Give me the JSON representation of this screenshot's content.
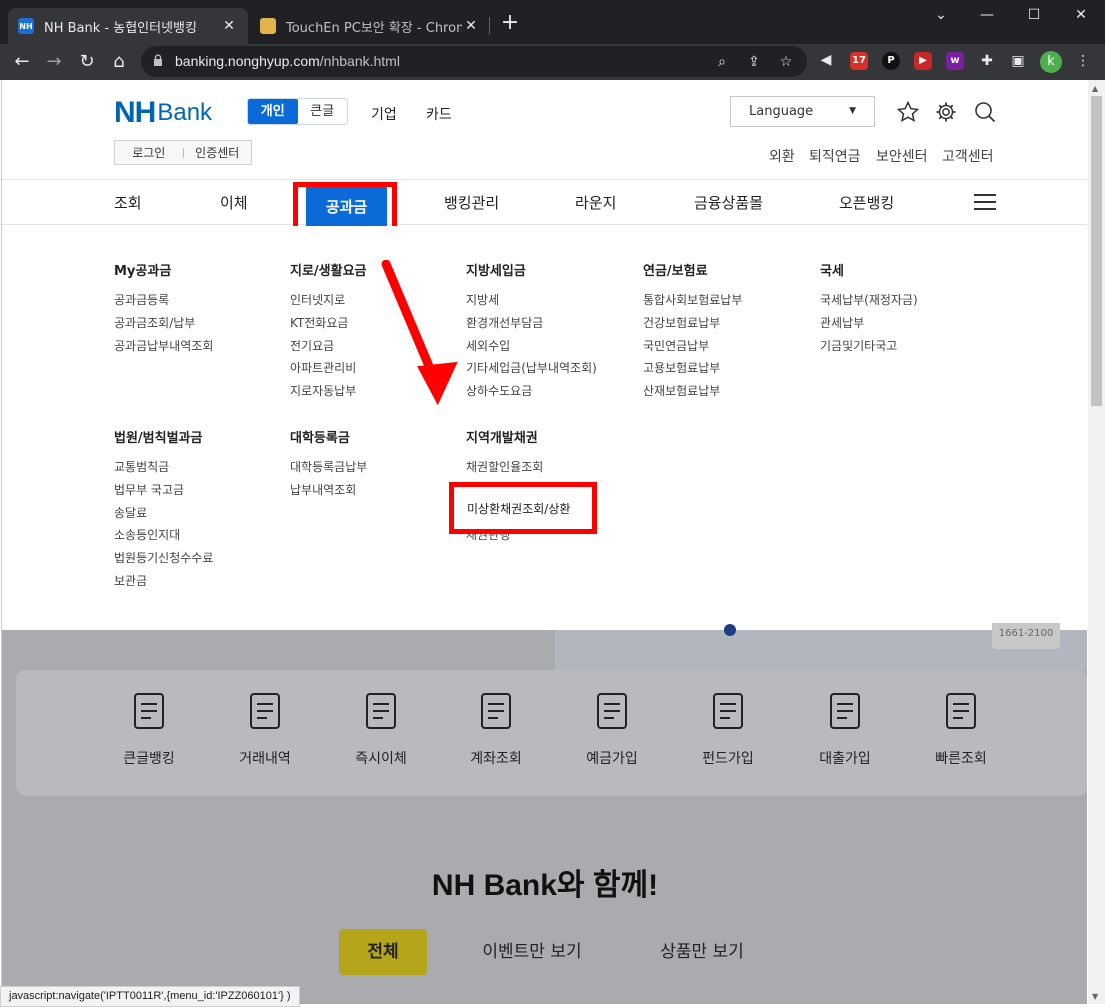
{
  "browser": {
    "tabs": [
      {
        "title": "NH Bank - 농협인터넷뱅킹",
        "favicon": "NH"
      },
      {
        "title": "TouchEn PC보안 확장 - Chrome"
      }
    ],
    "url_host": "banking.nonghyup.com",
    "url_path": "/nhbank.html",
    "extension_badge": "17",
    "profile_initial": "k",
    "status_bar": "javascript:navigate('IPTT0011R',{menu_id:'IPZZ060101'} )"
  },
  "header": {
    "logo_nh": "NH",
    "logo_bank": "Bank",
    "segment": [
      "개인",
      "큰글"
    ],
    "top_links": [
      "기업",
      "카드"
    ],
    "login": "로그인",
    "cert": "인증센터",
    "language": "Language",
    "util_links": [
      "외환",
      "퇴직연금",
      "보안센터",
      "고객센터"
    ]
  },
  "gnb": {
    "items": [
      "조회",
      "이체",
      "공과금",
      "뱅킹관리",
      "라운지",
      "금융상품몰",
      "오픈뱅킹"
    ],
    "active": "공과금"
  },
  "mega_menu": {
    "row1": [
      {
        "title": "My공과금",
        "items": [
          "공과금등록",
          "공과금조회/납부",
          "공과금납부내역조회"
        ]
      },
      {
        "title": "지로/생활요금",
        "items": [
          "인터넷지로",
          "KT전화요금",
          "전기요금",
          "아파트관리비",
          "지로자동납부"
        ]
      },
      {
        "title": "지방세입금",
        "items": [
          "지방세",
          "환경개선부담금",
          "세외수입",
          "기타세입금(납부내역조회)",
          "상하수도요금"
        ]
      },
      {
        "title": "연금/보험료",
        "items": [
          "통합사회보험료납부",
          "건강보험료납부",
          "국민연금납부",
          "고용보험료납부",
          "산재보험료납부"
        ]
      },
      {
        "title": "국세",
        "items": [
          "국세납부(재정자금)",
          "관세납부",
          "기금및기타국고"
        ]
      }
    ],
    "row2": [
      {
        "title": "법원/범칙벌과금",
        "items": [
          "교통범칙금",
          "법무부 국고금",
          "송달료",
          "소송등인지대",
          "법원등기신청수수료",
          "보관금"
        ]
      },
      {
        "title": "대학등록금",
        "items": [
          "대학등록금납부",
          "납부내역조회"
        ]
      },
      {
        "title": "지역개발채권",
        "items": [
          "채권할인율조회",
          "",
          "",
          "채권관행"
        ]
      }
    ],
    "highlighted_item": "미상환채권조회/상환"
  },
  "quick_menu": [
    "큰글뱅킹",
    "거래내역",
    "즉시이체",
    "계좌조회",
    "예금가입",
    "펀드가입",
    "대출가입",
    "빠른조회"
  ],
  "call_number": "1661-2100",
  "promo": {
    "title": "NH Bank와 함께!",
    "filters": [
      "전체",
      "이벤트만 보기",
      "상품만 보기"
    ]
  },
  "colors": {
    "brand": "#0066b3",
    "accent": "#0a6bd8",
    "highlight": "#ff0000"
  }
}
